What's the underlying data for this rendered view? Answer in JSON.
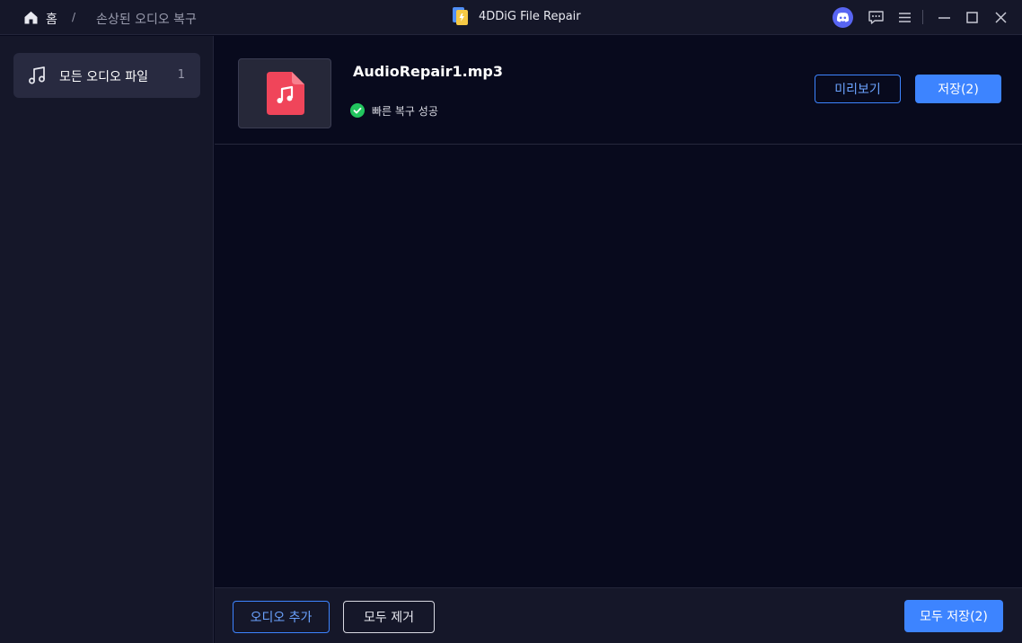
{
  "titlebar": {
    "home_label": "홈",
    "separator": "/",
    "current_page": "손상된 오디오 복구",
    "app_title": "4DDiG File Repair"
  },
  "sidebar": {
    "items": [
      {
        "label": "모든 오디오 파일",
        "count": "1",
        "icon": "music-note-icon"
      }
    ]
  },
  "file": {
    "name": "AudioRepair1.mp3",
    "status": "빠른 복구 성공",
    "preview_label": "미리보기",
    "save_label": "저장(2)"
  },
  "footer": {
    "add_label": "오디오 추가",
    "remove_label": "모두 제거",
    "save_all_label": "모두 저장(2)"
  },
  "colors": {
    "accent": "#3d84ff",
    "success": "#22c55e",
    "file_icon": "#f0455a",
    "discord": "#5865f2"
  }
}
